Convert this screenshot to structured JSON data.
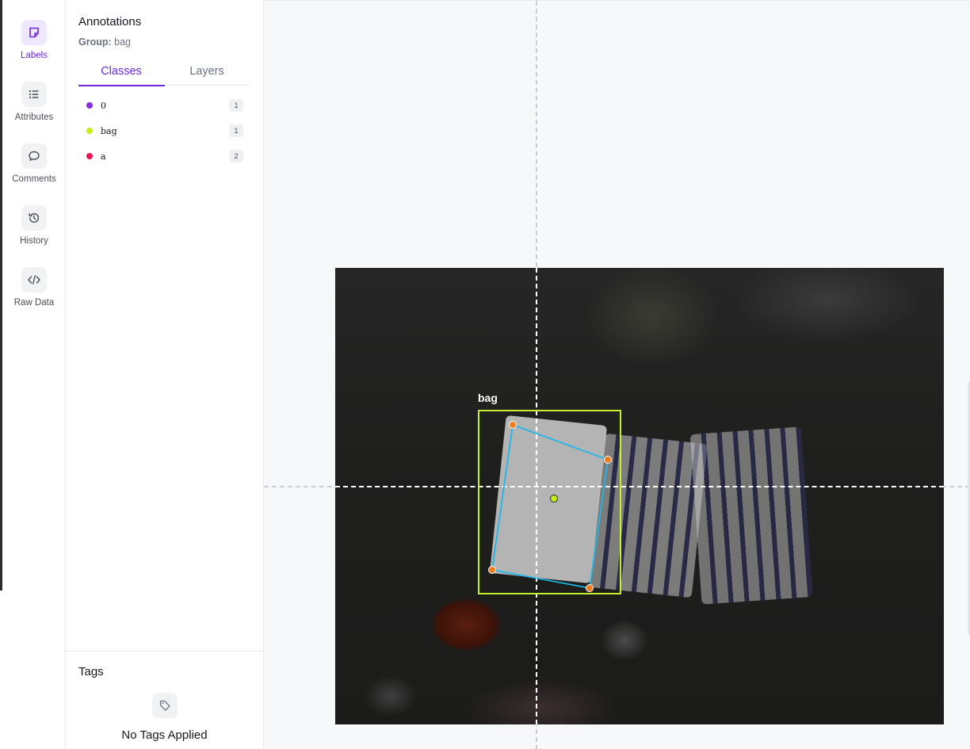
{
  "sidebar": {
    "items": [
      {
        "label": "Labels",
        "icon": "sticky-note-icon",
        "active": true
      },
      {
        "label": "Attributes",
        "icon": "list-icon",
        "active": false
      },
      {
        "label": "Comments",
        "icon": "speech-bubble-icon",
        "active": false
      },
      {
        "label": "History",
        "icon": "history-clock-icon",
        "active": false
      },
      {
        "label": "Raw Data",
        "icon": "code-brackets-icon",
        "active": false
      }
    ]
  },
  "annotations": {
    "title": "Annotations",
    "group_label": "Group:",
    "group_value": "bag",
    "tabs": [
      {
        "label": "Classes",
        "active": true
      },
      {
        "label": "Layers",
        "active": false
      }
    ],
    "classes": [
      {
        "name": "0",
        "count": "1",
        "color": "#8b2be2"
      },
      {
        "name": "bag",
        "count": "1",
        "color": "#c3ee17"
      },
      {
        "name": "a",
        "count": "2",
        "color": "#e8174f"
      }
    ]
  },
  "tags": {
    "title": "Tags",
    "empty_text": "No Tags Applied",
    "icon": "tag-icon"
  },
  "canvas": {
    "box_label": "bag",
    "box_color": "#c7f02c",
    "polygon_color": "#1fb6ea",
    "vertex_color": "#f07a1c",
    "center_point_color": "#c3ee17"
  },
  "colors": {
    "accent": "#6d28d9"
  }
}
